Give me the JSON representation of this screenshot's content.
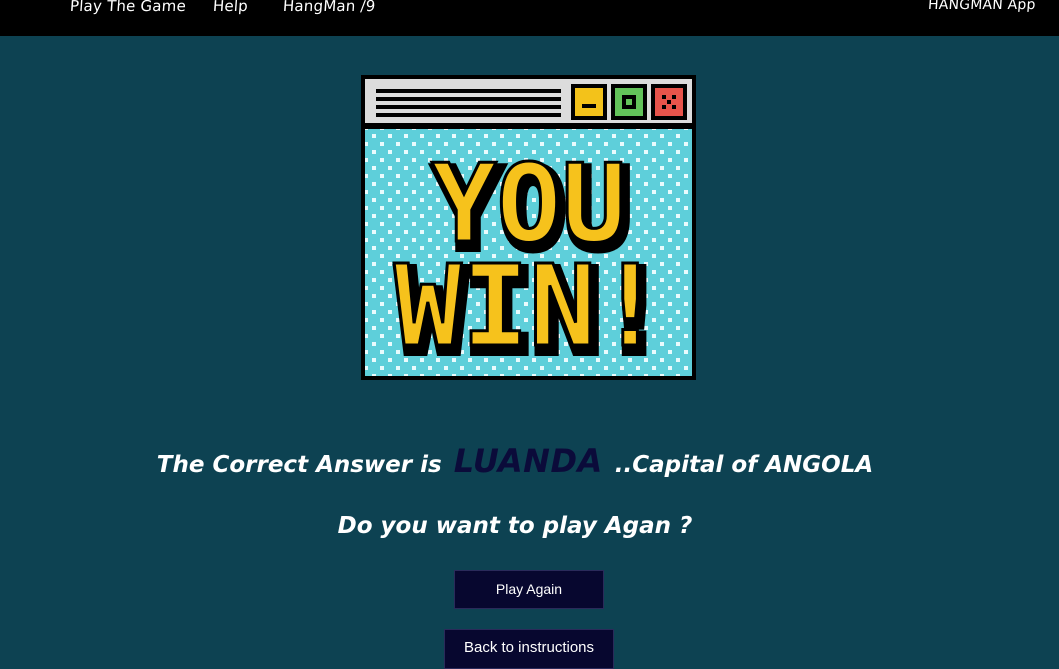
{
  "nav": {
    "links": [
      "Play The Game",
      "Help",
      "HangMan /9"
    ],
    "brand": "HANGMAN App"
  },
  "win_image": {
    "line1": "YOU",
    "line2": "WIN!",
    "colors": {
      "sky": "#5ecfda",
      "letter": "#f6c21c",
      "title_bar": "#dcdcdc",
      "minimize": "#f3c21a",
      "maximize": "#63c35a",
      "close": "#e8544b"
    }
  },
  "result": {
    "prefix": "The Correct Answer is",
    "answer": "LUANDA",
    "suffix": "..Capital of ANGOLA",
    "prompt": "Do you want to play Agan ?"
  },
  "buttons": {
    "play_again": "Play Again",
    "back": "Back to instructions"
  }
}
